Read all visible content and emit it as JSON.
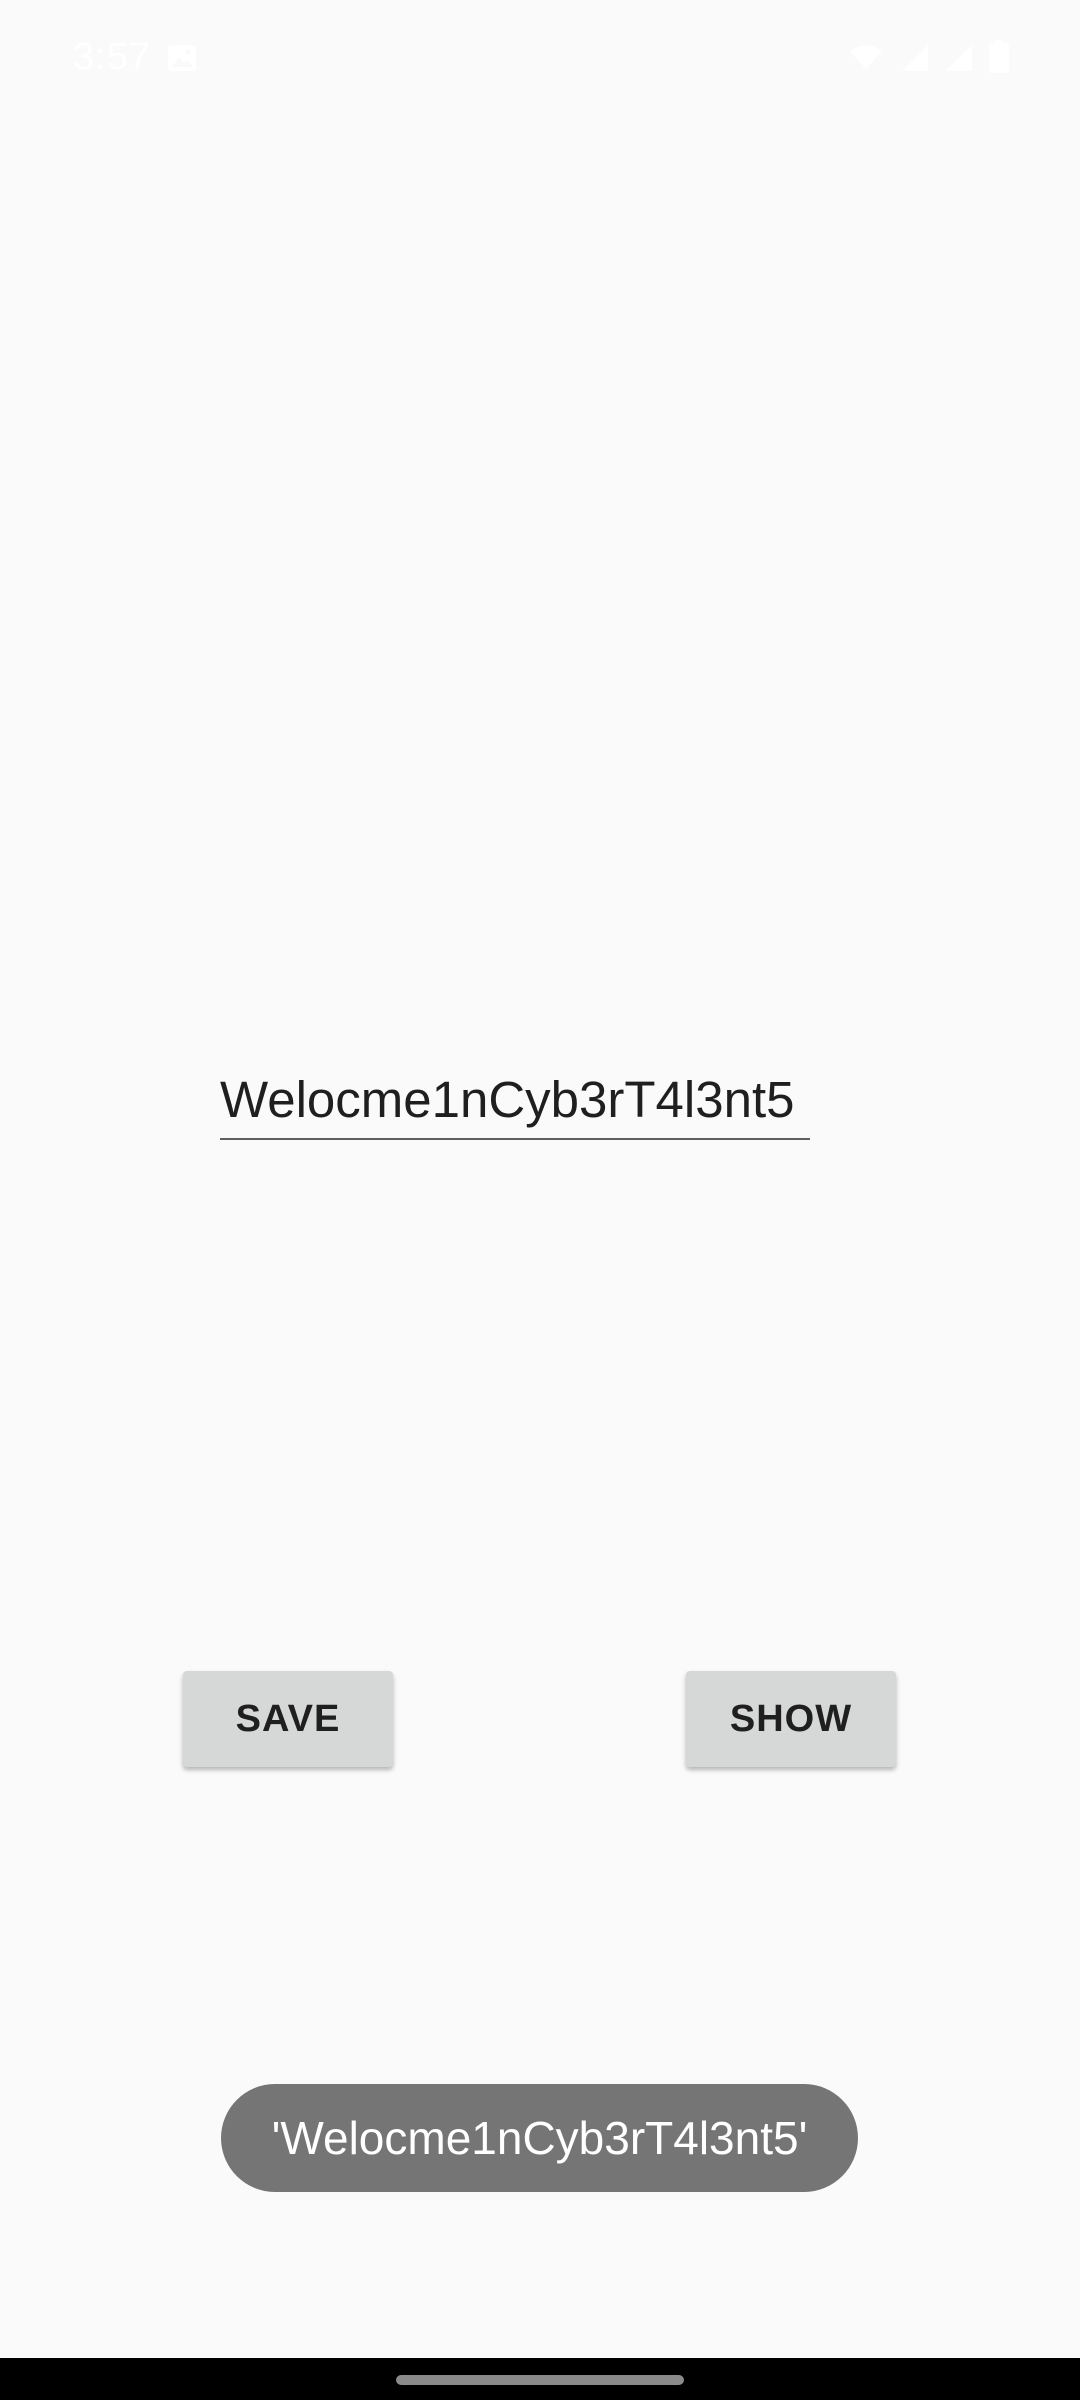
{
  "status_bar": {
    "time": "3:57",
    "icons": [
      "image-notification-icon",
      "wifi-icon",
      "signal-icon",
      "signal-icon-2",
      "battery-icon"
    ]
  },
  "main": {
    "input_value": "Welocme1nCyb3rT4l3nt5",
    "save_label": "SAVE",
    "show_label": "SHOW"
  },
  "toast": {
    "message": "'Welocme1nCyb3rT4l3nt5'"
  },
  "colors": {
    "background": "#fafafa",
    "button": "#d6d7d7",
    "toast": "#757575",
    "nav_bar": "#000000"
  }
}
